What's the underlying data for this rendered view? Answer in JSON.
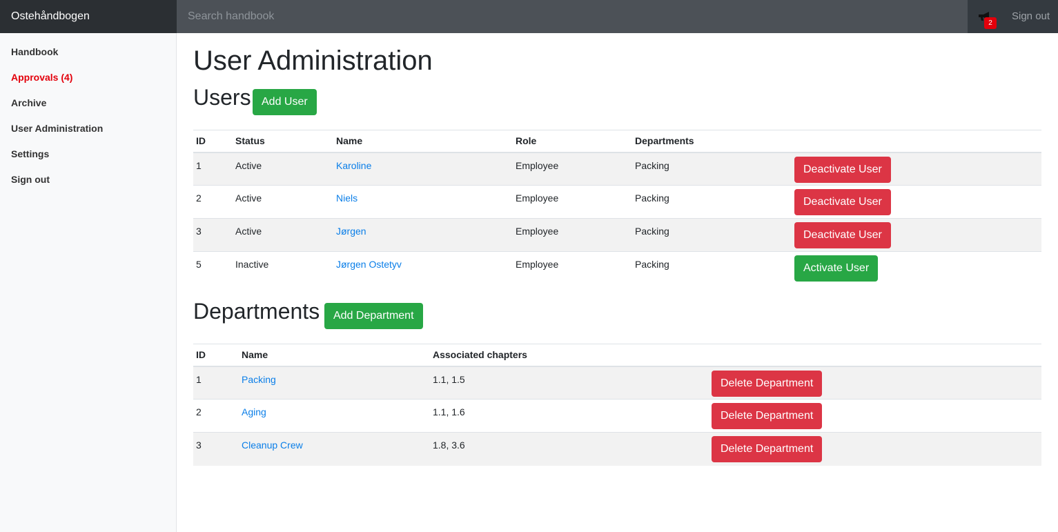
{
  "header": {
    "brand": "Ostehåndbogen",
    "search_placeholder": "Search handbook",
    "notification_count": "2",
    "signout_label": "Sign out"
  },
  "sidebar": {
    "items": [
      {
        "label": "Handbook"
      },
      {
        "label": "Approvals (4)"
      },
      {
        "label": "Archive"
      },
      {
        "label": "User Administration"
      },
      {
        "label": "Settings"
      },
      {
        "label": "Sign out"
      }
    ]
  },
  "page": {
    "title": "User Administration"
  },
  "users": {
    "heading": "Users",
    "add_label": "Add User",
    "columns": [
      "ID",
      "Status",
      "Name",
      "Role",
      "Departments"
    ],
    "rows": [
      {
        "id": "1",
        "status": "Active",
        "name": "Karoline",
        "role": "Employee",
        "departments": "Packing",
        "action": "Deactivate User"
      },
      {
        "id": "2",
        "status": "Active",
        "name": "Niels",
        "role": "Employee",
        "departments": "Packing",
        "action": "Deactivate User"
      },
      {
        "id": "3",
        "status": "Active",
        "name": "Jørgen",
        "role": "Employee",
        "departments": "Packing",
        "action": "Deactivate User"
      },
      {
        "id": "5",
        "status": "Inactive",
        "name": "Jørgen Ostetyv",
        "role": "Employee",
        "departments": "Packing",
        "action": "Activate User"
      }
    ]
  },
  "departments": {
    "heading": "Departments",
    "add_label": "Add Department",
    "columns": [
      "ID",
      "Name",
      "Associated chapters"
    ],
    "rows": [
      {
        "id": "1",
        "name": "Packing",
        "chapters": "1.1, 1.5",
        "action": "Delete Department"
      },
      {
        "id": "2",
        "name": "Aging",
        "chapters": "1.1, 1.6",
        "action": "Delete Department"
      },
      {
        "id": "3",
        "name": "Cleanup Crew",
        "chapters": "1.8, 3.6",
        "action": "Delete Department"
      }
    ]
  },
  "colors": {
    "topbar": "#343a40",
    "success": "#28a745",
    "danger": "#dc3545",
    "link": "#0a7ee8",
    "active_nav": "#e3000b"
  }
}
